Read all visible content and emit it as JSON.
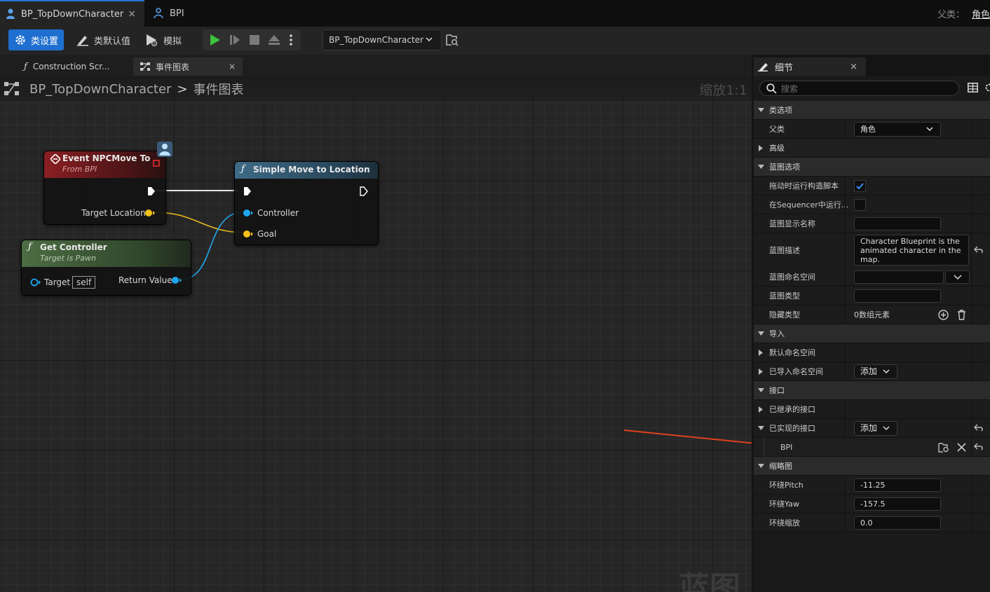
{
  "document_tabs": [
    {
      "label": "BP_TopDownCharacter",
      "close": "×"
    },
    {
      "label": "BPI"
    }
  ],
  "parent_class": {
    "label": "父类：",
    "value": "角色"
  },
  "toolbar": {
    "class_settings": "类设置",
    "class_defaults": "类默认值",
    "simulate": "模拟",
    "debug_object": "BP_TopDownCharacter"
  },
  "graph_tabs": [
    {
      "label": "Construction Scr..."
    },
    {
      "label": "事件图表",
      "close": "×"
    }
  ],
  "graph": {
    "breadcrumb_root": "BP_TopDownCharacter",
    "breadcrumb_sep": ">",
    "breadcrumb_current": "事件图表",
    "zoom": "缩放1:1",
    "watermark": "蓝图",
    "nodes": {
      "event": {
        "title": "Event NPCMove To",
        "subtitle": "From BPI",
        "pin_target_location": "Target Location"
      },
      "simple_move": {
        "title": "Simple Move to Location",
        "pin_controller": "Controller",
        "pin_goal": "Goal"
      },
      "get_controller": {
        "title": "Get Controller",
        "subtitle": "Target is Pawn",
        "pin_target": "Target",
        "target_default": "self",
        "pin_return": "Return Value"
      }
    },
    "colors": {
      "exec": "#ffffff",
      "vector_pin": "#f2c21a",
      "object_pin": "#1ea6f0",
      "event_header": "#8a1f23",
      "function_header": "#3f6b86",
      "pure_header": "#4c6d43"
    }
  },
  "details": {
    "tab_label": "细节",
    "close": "×",
    "search_placeholder": "搜索",
    "rows": {
      "cat_class_options": "类选项",
      "parent_class": "父类",
      "parent_class_value": "角色",
      "advanced": "高级",
      "cat_blueprint_options": "蓝图选项",
      "run_construction_on_drag": "拖动时运行构造脚本",
      "run_in_sequencer": "在Sequencer中运行...",
      "display_name": "蓝图显示名称",
      "description": "蓝图描述",
      "description_value": "Character Blueprint is the animated character in the map.",
      "namespace": "蓝图命名空间",
      "blueprint_type": "蓝图类型",
      "hide_categories": "隐藏类型",
      "hide_categories_value": "0数组元素",
      "cat_imports": "导入",
      "default_namespaces": "默认命名空间",
      "imported_namespaces": "已导入命名空间",
      "add": "添加",
      "cat_interfaces": "接口",
      "inherited_interfaces": "已继承的接口",
      "implemented_interfaces": "已实现的接口",
      "bpi": "BPI",
      "cat_thumbnail": "缩略图",
      "orbit_pitch": "环绕Pitch",
      "orbit_pitch_value": "-11.25",
      "orbit_yaw": "环绕Yaw",
      "orbit_yaw_value": "-157.5",
      "orbit_zoom": "环绕缩放",
      "orbit_zoom_value": "0.0"
    },
    "accent": "#2673d4",
    "annotation_arrow_color": "#e0401e"
  }
}
